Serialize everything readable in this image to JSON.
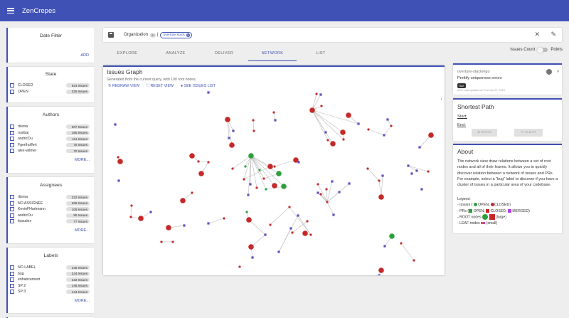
{
  "app": {
    "title": "ZenCrepes"
  },
  "filters": {
    "date": {
      "title": "Date Filter",
      "add_label": "ADD"
    },
    "state": {
      "title": "State",
      "items": [
        {
          "label": "CLOSED",
          "count": "924 Issues"
        },
        {
          "label": "OPEN",
          "count": "326 Issues"
        }
      ]
    },
    "authors": {
      "title": "Authors",
      "more_label": "MORE...",
      "items": [
        {
          "label": "rtisma",
          "count": "307 Issues"
        },
        {
          "label": "rosibaj",
          "count": "166 Issues"
        },
        {
          "label": "andricDu",
          "count": "111 Issues"
        },
        {
          "label": "Fgerthoffert",
          "count": "75 Issues"
        },
        {
          "label": "alex-wilmer",
          "count": "70 Issues"
        }
      ]
    },
    "assignees": {
      "title": "Assignees",
      "more_label": "MORE...",
      "items": [
        {
          "label": "rtisma",
          "count": "322 Issues"
        },
        {
          "label": "NO ASSIGNEE",
          "count": "269 Issues"
        },
        {
          "label": "KevinFHartmann",
          "count": "109 Issues"
        },
        {
          "label": "andricDu",
          "count": "95 Issues"
        },
        {
          "label": "lepsalex",
          "count": "77 Issues"
        }
      ]
    },
    "labels": {
      "title": "Labels",
      "more_label": "MORE...",
      "items": [
        {
          "label": "NO LABEL",
          "count": "245 Issues"
        },
        {
          "label": "bug",
          "count": "244 Issues"
        },
        {
          "label": "enhancement",
          "count": "232 Issues"
        },
        {
          "label": "SP:2",
          "count": "146 Issues"
        },
        {
          "label": "SP:3",
          "count": "144 Issues"
        }
      ]
    }
  },
  "query": {
    "field": "Organization",
    "operator": "in",
    "paren": "(",
    "value": "overture-stack"
  },
  "tabs": [
    {
      "label": "EXPLORE"
    },
    {
      "label": "ANALYZE"
    },
    {
      "label": "DELIVER"
    },
    {
      "label": "NETWORK",
      "active": true
    },
    {
      "label": "LIST"
    }
  ],
  "toggle": {
    "left": "Issues Count",
    "right": "Points"
  },
  "graph": {
    "title": "Issues Graph",
    "subtitle": "Generated from the current query, with 100 root nodes.",
    "actions": {
      "redraw": "REDRAW VIEW",
      "reset": "RESET VIEW",
      "see_list": "SEE ISSUES LIST"
    },
    "info": "i",
    "colors": {
      "closed": "#c62828",
      "open": "#2e9e3e",
      "pr": "#5c4fc4",
      "edge": "#bbbbbb"
    }
  },
  "issue_card": {
    "repo": "overture-stack/ego",
    "number": "#",
    "title": "Prettify uniqueness errors",
    "label": "fizz",
    "meta": "#FIX Last updated on Thu Jun 27, 2019"
  },
  "shortest_path": {
    "title": "Shortest Path",
    "start": "Start:",
    "end": "End:",
    "draw": "DRAW",
    "clear": "CLEAR"
  },
  "about": {
    "title": "About",
    "body": "The network view draw relations between a set of root nodes and all of their leaves. It allows you to quickly discover relation between a network of issues and PRs. For example, select a \"bug\" label to discover if you have a cluster of issues in a particular area of your codebase.",
    "legend_title": "Legend:",
    "issues_prefix": "- Issues (",
    "open": "OPEN,",
    "closed": "CLOSED)",
    "prs_prefix": "- PRs (",
    "pr_open": "OPEN,",
    "pr_closed": "CLOSED,",
    "pr_merged": "MERGED)",
    "root": "- ROOT nodes",
    "root_suffix": "(large)",
    "leaf": "- LEAF nodes",
    "leaf_suffix": "(small)"
  }
}
